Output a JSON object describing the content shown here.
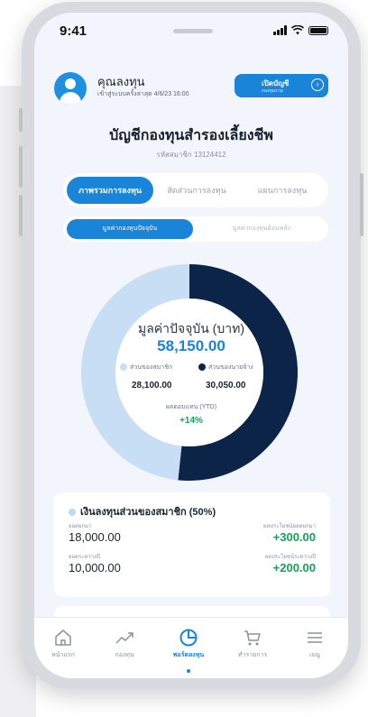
{
  "status_bar": {
    "time": "9:41"
  },
  "user": {
    "name": "คุณลงทุน",
    "last_login": "เข้าสู่ระบบครั้งล่าสุด 4/6/23 16:00"
  },
  "open_account_button": {
    "label": "เปิดบัญชี",
    "sublabel": "กองทุนรวม"
  },
  "account": {
    "title": "บัญชีกองทุนสำรองเลี้ยงชีพ",
    "member_code": "รหัสสมาชิก 13124412"
  },
  "tabs": [
    {
      "label": "ภาพรวมการลงทุน",
      "active": true
    },
    {
      "label": "สัดส่วนการลงทุน",
      "active": false
    },
    {
      "label": "แผนการลงทุน",
      "active": false
    }
  ],
  "subtabs": [
    {
      "label": "มูลค่ากองทุนปัจจุบัน",
      "active": true
    },
    {
      "label": "มูลค่ากองทุนย้อนหลัง",
      "active": false
    }
  ],
  "summary": {
    "current_value_label": "มูลค่าปัจจุบัน (บาท)",
    "current_value": "58,150.00",
    "member_label": "ส่วนของสมาชิก",
    "member_value": "28,100.00",
    "employer_label": "ส่วนของนายจ้าง",
    "employer_value": "30,050.00",
    "ytd_label": "ผลตอบแทน (YTD)",
    "ytd_value": "+14%"
  },
  "chart_data": {
    "type": "pie",
    "categories": [
      "ส่วนของสมาชิก",
      "ส่วนของนายจ้าง"
    ],
    "values": [
      28100.0,
      30050.0
    ],
    "colors": [
      "#c7def4",
      "#0b2447"
    ]
  },
  "member_card": {
    "title": "เงินลงทุนส่วนของสมาชิก (50%)",
    "principal_label": "ยอดยกมา",
    "principal_value": "18,000.00",
    "principal_gain_label": "ผลประโยชน์ยอดยกมา",
    "principal_gain_value": "+300.00",
    "period_label": "ยอดระหว่างปี",
    "period_value": "10,000.00",
    "period_gain_label": "ผลประโยชน์ระหว่างปี",
    "period_gain_value": "+200.00"
  },
  "bottom_nav": [
    {
      "label": "หน้าแรก",
      "icon": "home-icon",
      "active": false
    },
    {
      "label": "กองทุน",
      "icon": "trend-icon",
      "active": false
    },
    {
      "label": "พอร์ตลงทุน",
      "icon": "pie-chart-icon",
      "active": true
    },
    {
      "label": "ทำรายการ",
      "icon": "cart-icon",
      "active": false
    },
    {
      "label": "เมนู",
      "icon": "menu-icon",
      "active": false
    }
  ],
  "colors": {
    "primary": "#1a84d8",
    "employer_navy": "#0b2447",
    "member_light": "#c7def4",
    "gain_green": "#18a05a"
  }
}
